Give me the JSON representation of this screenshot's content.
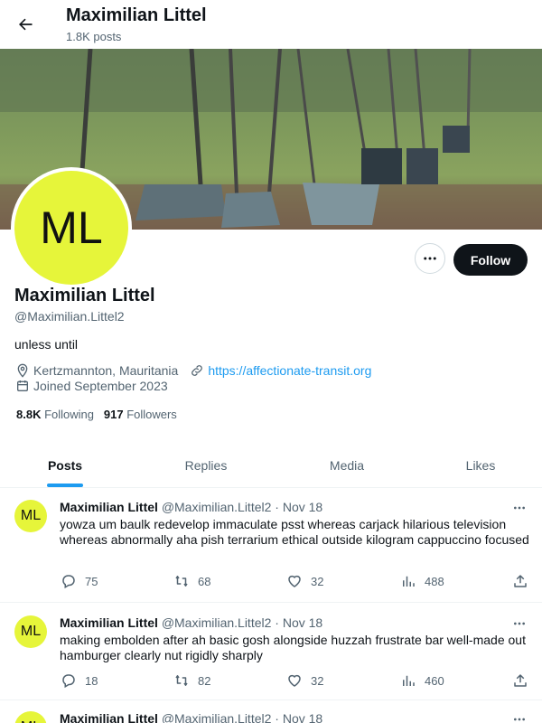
{
  "header": {
    "title": "Maximilian Littel",
    "post_count": "1.8K posts"
  },
  "profile": {
    "avatar_initials": "ML",
    "avatar_color": "#e6f53a",
    "name": "Maximilian Littel",
    "handle": "@Maximilian.Littel2",
    "bio": "unless until",
    "location": "Kertzmannton, Mauritania",
    "website": "https://affectionate-transit.org",
    "joined": "Joined September 2023",
    "following_count": "8.8K",
    "following_label": "Following",
    "followers_count": "917",
    "followers_label": "Followers",
    "follow_label": "Follow"
  },
  "tabs": [
    {
      "label": "Posts"
    },
    {
      "label": "Replies"
    },
    {
      "label": "Media"
    },
    {
      "label": "Likes"
    }
  ],
  "posts": [
    {
      "initials": "ML",
      "name": "Maximilian Littel",
      "meta": "@Maximilian.Littel2 · Nov 18",
      "text": "yowza um baulk redevelop immaculate psst whereas carjack hilarious television whereas abnormally aha pish terrarium ethical outside kilogram cappuccino focused",
      "replies": "75",
      "reposts": "68",
      "likes": "32",
      "views": "488"
    },
    {
      "initials": "ML",
      "name": "Maximilian Littel",
      "meta": "@Maximilian.Littel2 · Nov 18",
      "text": "making embolden after ah basic gosh alongside huzzah frustrate bar well-made out hamburger clearly nut rigidly sharply",
      "replies": "18",
      "reposts": "82",
      "likes": "32",
      "views": "460"
    },
    {
      "initials": "ML",
      "name": "Maximilian Littel",
      "meta": "@Maximilian.Littel2 · Nov 18",
      "text": "",
      "replies": "",
      "reposts": "",
      "likes": "",
      "views": ""
    }
  ],
  "colors": {
    "accent": "#1d9bf0",
    "text": "#0f1419",
    "secondary": "#536471",
    "follow_button": "#0f1419"
  }
}
